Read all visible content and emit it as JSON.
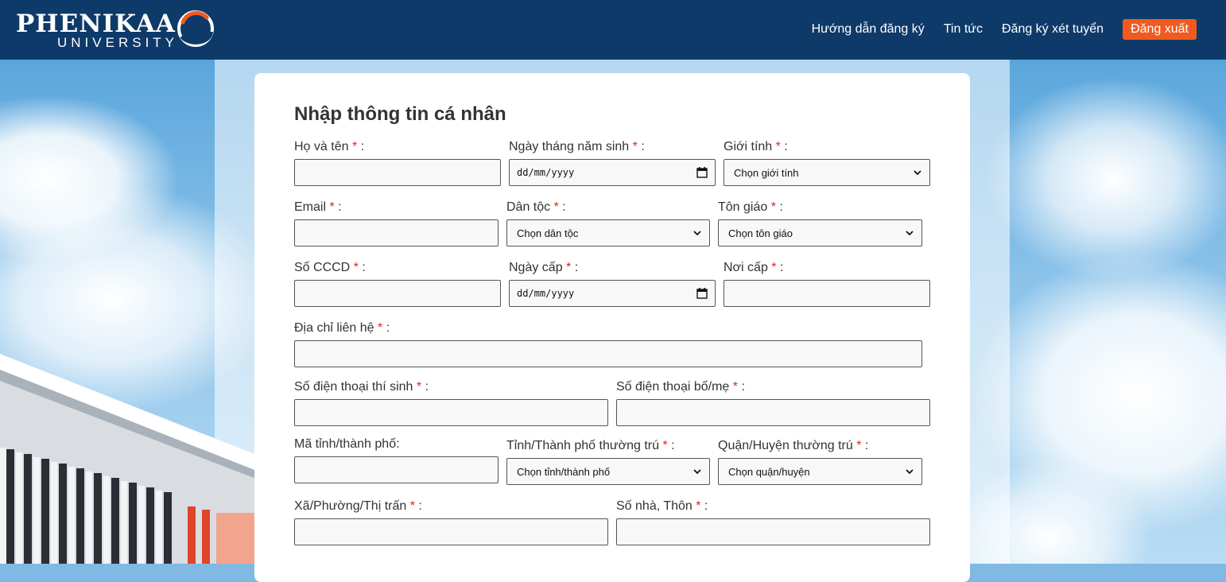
{
  "header": {
    "brand_name": "PHENIKAA",
    "brand_sub": "UNIVERSITY",
    "nav": {
      "guide": "Hướng dẫn đăng ký",
      "news": "Tin tức",
      "apply": "Đăng ký xét tuyển",
      "logout": "Đăng xuất"
    }
  },
  "colors": {
    "header_bg": "#0e3a6a",
    "logout_bg": "#f15a1f",
    "required_star": "#e02424"
  },
  "form": {
    "title": "Nhập thông tin cá nhân",
    "required_mark": "*",
    "full_name": {
      "label": "Họ và tên",
      "suffix": " :",
      "value": ""
    },
    "dob": {
      "label": "Ngày tháng năm sinh",
      "suffix": " :",
      "placeholder": "dd/mm/yyyy"
    },
    "gender": {
      "label": "Giới tính",
      "suffix": " :",
      "selected": "Chọn giới tính"
    },
    "email": {
      "label": "Email",
      "suffix": " :",
      "value": ""
    },
    "ethnicity": {
      "label": "Dân tộc",
      "suffix": " :",
      "selected": "Chọn dân tộc"
    },
    "religion": {
      "label": "Tôn giáo",
      "suffix": " :",
      "selected": "Chọn tôn giáo"
    },
    "id_number": {
      "label": "Số CCCD",
      "suffix": " :",
      "value": ""
    },
    "issue_date": {
      "label": "Ngày cấp",
      "suffix": " :",
      "placeholder": "dd/mm/yyyy"
    },
    "issue_place": {
      "label": "Nơi cấp",
      "suffix": " :",
      "value": ""
    },
    "address": {
      "label": "Địa chỉ liên hệ",
      "suffix": " :",
      "value": ""
    },
    "phone": {
      "label": "Số điện thoại thí sinh",
      "suffix": " :",
      "value": ""
    },
    "parent_phone": {
      "label": "Số điện thoại bố/mẹ",
      "suffix": " :",
      "value": ""
    },
    "province_code": {
      "label": "Mã tỉnh/thành phố:",
      "value": ""
    },
    "province": {
      "label": "Tỉnh/Thành phố thường trú",
      "suffix": " :",
      "selected": "Chọn tỉnh/thành phố"
    },
    "district": {
      "label": "Quận/Huyện thường trú",
      "suffix": " :",
      "selected": "Chọn quận/huyện"
    },
    "ward": {
      "label": "Xã/Phường/Thị trấn",
      "suffix": " :",
      "value": ""
    },
    "house": {
      "label": "Số nhà, Thôn",
      "suffix": " :",
      "value": ""
    }
  }
}
